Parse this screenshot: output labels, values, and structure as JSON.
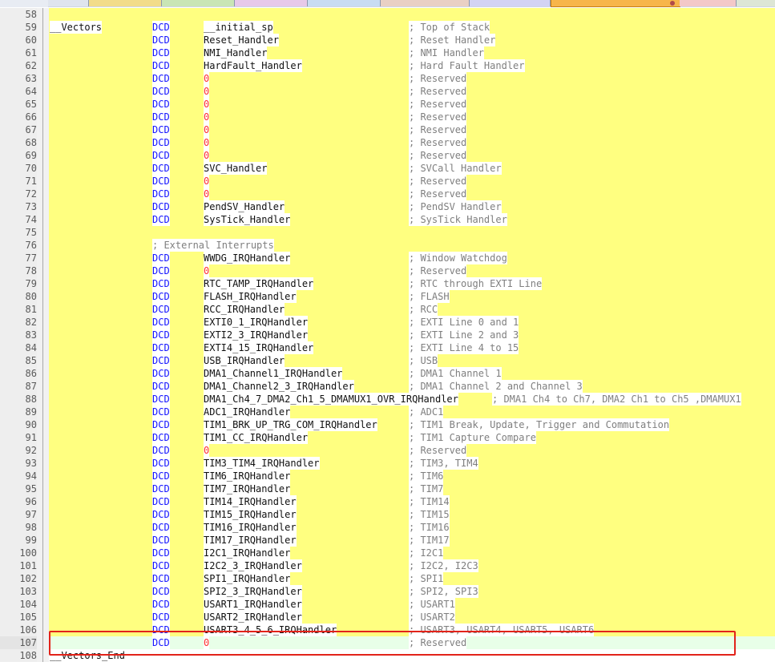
{
  "editor": {
    "rows": [
      {
        "line": "58",
        "label": "",
        "kw": "",
        "op": "",
        "comment": "",
        "op_numeric": false
      },
      {
        "line": "59",
        "label": "__Vectors",
        "kw": "DCD",
        "op": "__initial_sp",
        "comment": "; Top of Stack",
        "op_numeric": false
      },
      {
        "line": "60",
        "label": "",
        "kw": "DCD",
        "op": "Reset_Handler",
        "comment": "; Reset Handler",
        "op_numeric": false
      },
      {
        "line": "61",
        "label": "",
        "kw": "DCD",
        "op": "NMI_Handler",
        "comment": "; NMI Handler",
        "op_numeric": false
      },
      {
        "line": "62",
        "label": "",
        "kw": "DCD",
        "op": "HardFault_Handler",
        "comment": "; Hard Fault Handler",
        "op_numeric": false
      },
      {
        "line": "63",
        "label": "",
        "kw": "DCD",
        "op": "0",
        "comment": "; Reserved",
        "op_numeric": true
      },
      {
        "line": "64",
        "label": "",
        "kw": "DCD",
        "op": "0",
        "comment": "; Reserved",
        "op_numeric": true
      },
      {
        "line": "65",
        "label": "",
        "kw": "DCD",
        "op": "0",
        "comment": "; Reserved",
        "op_numeric": true
      },
      {
        "line": "66",
        "label": "",
        "kw": "DCD",
        "op": "0",
        "comment": "; Reserved",
        "op_numeric": true
      },
      {
        "line": "67",
        "label": "",
        "kw": "DCD",
        "op": "0",
        "comment": "; Reserved",
        "op_numeric": true
      },
      {
        "line": "68",
        "label": "",
        "kw": "DCD",
        "op": "0",
        "comment": "; Reserved",
        "op_numeric": true
      },
      {
        "line": "69",
        "label": "",
        "kw": "DCD",
        "op": "0",
        "comment": "; Reserved",
        "op_numeric": true
      },
      {
        "line": "70",
        "label": "",
        "kw": "DCD",
        "op": "SVC_Handler",
        "comment": "; SVCall Handler",
        "op_numeric": false
      },
      {
        "line": "71",
        "label": "",
        "kw": "DCD",
        "op": "0",
        "comment": "; Reserved",
        "op_numeric": true
      },
      {
        "line": "72",
        "label": "",
        "kw": "DCD",
        "op": "0",
        "comment": "; Reserved",
        "op_numeric": true
      },
      {
        "line": "73",
        "label": "",
        "kw": "DCD",
        "op": "PendSV_Handler",
        "comment": "; PendSV Handler",
        "op_numeric": false
      },
      {
        "line": "74",
        "label": "",
        "kw": "DCD",
        "op": "SysTick_Handler",
        "comment": "; SysTick Handler",
        "op_numeric": false
      },
      {
        "line": "75",
        "label": "",
        "kw": "",
        "op": "",
        "comment": "",
        "op_numeric": false
      },
      {
        "line": "76",
        "label": "",
        "kw": "",
        "op": "",
        "comment": "",
        "section_comment": "; External Interrupts",
        "op_numeric": false
      },
      {
        "line": "77",
        "label": "",
        "kw": "DCD",
        "op": "WWDG_IRQHandler",
        "comment": "; Window Watchdog",
        "op_numeric": false
      },
      {
        "line": "78",
        "label": "",
        "kw": "DCD",
        "op": "0",
        "comment": "; Reserved",
        "op_numeric": true
      },
      {
        "line": "79",
        "label": "",
        "kw": "DCD",
        "op": "RTC_TAMP_IRQHandler",
        "comment": "; RTC through EXTI Line",
        "op_numeric": false
      },
      {
        "line": "80",
        "label": "",
        "kw": "DCD",
        "op": "FLASH_IRQHandler",
        "comment": "; FLASH",
        "op_numeric": false
      },
      {
        "line": "81",
        "label": "",
        "kw": "DCD",
        "op": "RCC_IRQHandler",
        "comment": "; RCC",
        "op_numeric": false
      },
      {
        "line": "82",
        "label": "",
        "kw": "DCD",
        "op": "EXTI0_1_IRQHandler",
        "comment": "; EXTI Line 0 and 1",
        "op_numeric": false
      },
      {
        "line": "83",
        "label": "",
        "kw": "DCD",
        "op": "EXTI2_3_IRQHandler",
        "comment": "; EXTI Line 2 and 3",
        "op_numeric": false
      },
      {
        "line": "84",
        "label": "",
        "kw": "DCD",
        "op": "EXTI4_15_IRQHandler",
        "comment": "; EXTI Line 4 to 15",
        "op_numeric": false
      },
      {
        "line": "85",
        "label": "",
        "kw": "DCD",
        "op": "USB_IRQHandler",
        "comment": "; USB",
        "op_numeric": false
      },
      {
        "line": "86",
        "label": "",
        "kw": "DCD",
        "op": "DMA1_Channel1_IRQHandler",
        "comment": "; DMA1 Channel 1",
        "op_numeric": false
      },
      {
        "line": "87",
        "label": "",
        "kw": "DCD",
        "op": "DMA1_Channel2_3_IRQHandler",
        "comment": "; DMA1 Channel 2 and Channel 3",
        "op_numeric": false
      },
      {
        "line": "88",
        "label": "",
        "kw": "DCD",
        "op": "DMA1_Ch4_7_DMA2_Ch1_5_DMAMUX1_OVR_IRQHandler",
        "comment": "; DMA1 Ch4 to Ch7, DMA2 Ch1 to Ch5 ,DMAMUX1",
        "op_numeric": false,
        "long": true
      },
      {
        "line": "89",
        "label": "",
        "kw": "DCD",
        "op": "ADC1_IRQHandler",
        "comment": "; ADC1",
        "op_numeric": false
      },
      {
        "line": "90",
        "label": "",
        "kw": "DCD",
        "op": "TIM1_BRK_UP_TRG_COM_IRQHandler",
        "comment": "; TIM1 Break, Update, Trigger and Commutation",
        "op_numeric": false
      },
      {
        "line": "91",
        "label": "",
        "kw": "DCD",
        "op": "TIM1_CC_IRQHandler",
        "comment": "; TIM1 Capture Compare",
        "op_numeric": false
      },
      {
        "line": "92",
        "label": "",
        "kw": "DCD",
        "op": "0",
        "comment": "; Reserved",
        "op_numeric": true
      },
      {
        "line": "93",
        "label": "",
        "kw": "DCD",
        "op": "TIM3_TIM4_IRQHandler",
        "comment": "; TIM3, TIM4",
        "op_numeric": false
      },
      {
        "line": "94",
        "label": "",
        "kw": "DCD",
        "op": "TIM6_IRQHandler",
        "comment": "; TIM6",
        "op_numeric": false
      },
      {
        "line": "95",
        "label": "",
        "kw": "DCD",
        "op": "TIM7_IRQHandler",
        "comment": "; TIM7",
        "op_numeric": false
      },
      {
        "line": "96",
        "label": "",
        "kw": "DCD",
        "op": "TIM14_IRQHandler",
        "comment": "; TIM14",
        "op_numeric": false
      },
      {
        "line": "97",
        "label": "",
        "kw": "DCD",
        "op": "TIM15_IRQHandler",
        "comment": "; TIM15",
        "op_numeric": false
      },
      {
        "line": "98",
        "label": "",
        "kw": "DCD",
        "op": "TIM16_IRQHandler",
        "comment": "; TIM16",
        "op_numeric": false
      },
      {
        "line": "99",
        "label": "",
        "kw": "DCD",
        "op": "TIM17_IRQHandler",
        "comment": "; TIM17",
        "op_numeric": false
      },
      {
        "line": "100",
        "label": "",
        "kw": "DCD",
        "op": "I2C1_IRQHandler",
        "comment": "; I2C1",
        "op_numeric": false
      },
      {
        "line": "101",
        "label": "",
        "kw": "DCD",
        "op": "I2C2_3_IRQHandler",
        "comment": "; I2C2, I2C3",
        "op_numeric": false
      },
      {
        "line": "102",
        "label": "",
        "kw": "DCD",
        "op": "SPI1_IRQHandler",
        "comment": "; SPI1",
        "op_numeric": false
      },
      {
        "line": "103",
        "label": "",
        "kw": "DCD",
        "op": "SPI2_3_IRQHandler",
        "comment": "; SPI2, SPI3",
        "op_numeric": false
      },
      {
        "line": "104",
        "label": "",
        "kw": "DCD",
        "op": "USART1_IRQHandler",
        "comment": "; USART1",
        "op_numeric": false
      },
      {
        "line": "105",
        "label": "",
        "kw": "DCD",
        "op": "USART2_IRQHandler",
        "comment": "; USART2",
        "op_numeric": false
      },
      {
        "line": "106",
        "label": "",
        "kw": "DCD",
        "op": "USART3_4_5_6_IRQHandler",
        "comment": "; USART3, USART4, USART5, USART6",
        "op_numeric": false
      },
      {
        "line": "107",
        "label": "",
        "kw": "DCD",
        "op": "0",
        "comment": "; Reserved",
        "op_numeric": true,
        "current": true
      },
      {
        "line": "108",
        "label": "__Vectors_End",
        "kw": "",
        "op": "",
        "comment": "",
        "op_numeric": false,
        "plain": true
      }
    ]
  },
  "colors": {
    "selection_yellow": "#ffff80",
    "keyword_blue": "#1414ff",
    "number_red": "#ff3030",
    "comment_gray": "#7f7f7f",
    "current_line_green": "#e8ffe8",
    "annotation_red": "#e2231a"
  }
}
